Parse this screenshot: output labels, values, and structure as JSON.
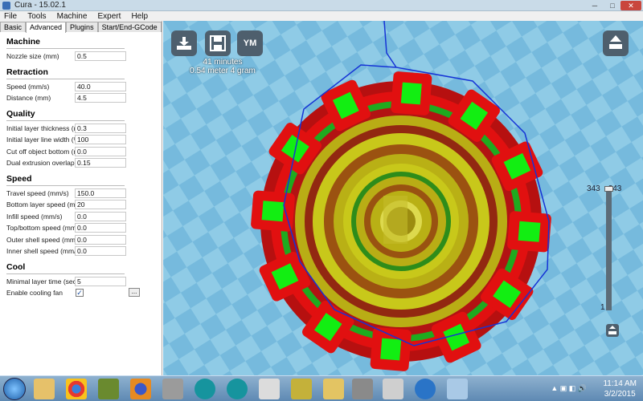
{
  "window": {
    "title": "Cura - 15.02.1",
    "min": "─",
    "max": "□",
    "close": "✕"
  },
  "menu": [
    "File",
    "Tools",
    "Machine",
    "Expert",
    "Help"
  ],
  "tabs": [
    "Basic",
    "Advanced",
    "Plugins",
    "Start/End-GCode"
  ],
  "active_tab": "Advanced",
  "sections": {
    "machine": {
      "title": "Machine",
      "rows": [
        {
          "label": "Nozzle size (mm)",
          "value": "0.5"
        }
      ]
    },
    "retraction": {
      "title": "Retraction",
      "rows": [
        {
          "label": "Speed (mm/s)",
          "value": "40.0"
        },
        {
          "label": "Distance (mm)",
          "value": "4.5"
        }
      ]
    },
    "quality": {
      "title": "Quality",
      "rows": [
        {
          "label": "Initial layer thickness (mm)",
          "value": "0.3"
        },
        {
          "label": "Initial layer line width (%)",
          "value": "100"
        },
        {
          "label": "Cut off object bottom (mm)",
          "value": "0.0"
        },
        {
          "label": "Dual extrusion overlap (mm)",
          "value": "0.15"
        }
      ]
    },
    "speed": {
      "title": "Speed",
      "rows": [
        {
          "label": "Travel speed (mm/s)",
          "value": "150.0"
        },
        {
          "label": "Bottom layer speed (mm/s)",
          "value": "20"
        },
        {
          "label": "Infill speed (mm/s)",
          "value": "0.0"
        },
        {
          "label": "Top/bottom speed (mm/s)",
          "value": "0.0"
        },
        {
          "label": "Outer shell speed (mm/s)",
          "value": "0.0"
        },
        {
          "label": "Inner shell speed (mm/s)",
          "value": "0.0"
        }
      ]
    },
    "cool": {
      "title": "Cool",
      "rows": [
        {
          "label": "Minimal layer time (sec)",
          "value": "5"
        }
      ],
      "fan_label": "Enable cooling fan",
      "fan_checked": "✓",
      "more_button": "..."
    }
  },
  "viewport": {
    "print_time": "41 minutes",
    "print_material": "0.54 meter 4 gram",
    "ym_label": "YM",
    "layer_top_label": "343",
    "layer_top_value": "343",
    "layer_bottom_label": "1",
    "colors": {
      "bed_light": "#8fcbe6",
      "bed_dark": "#6fb5d8",
      "outer_wall": "#e11010",
      "inner_wall": "#1faa1f",
      "infill": "#c8c81a",
      "travel": "#1533d6"
    }
  },
  "taskbar": {
    "icons": [
      "start-orb",
      "windows-explorer-icon",
      "chrome-icon",
      "app-icon",
      "firefox-icon",
      "app-icon",
      "arduino-icon",
      "arduino-icon",
      "app-icon",
      "app-icon",
      "app-icon",
      "app-icon",
      "app-icon",
      "cura-icon",
      "app-icon"
    ],
    "time": "11:14 AM",
    "date": "3/2/2015"
  }
}
